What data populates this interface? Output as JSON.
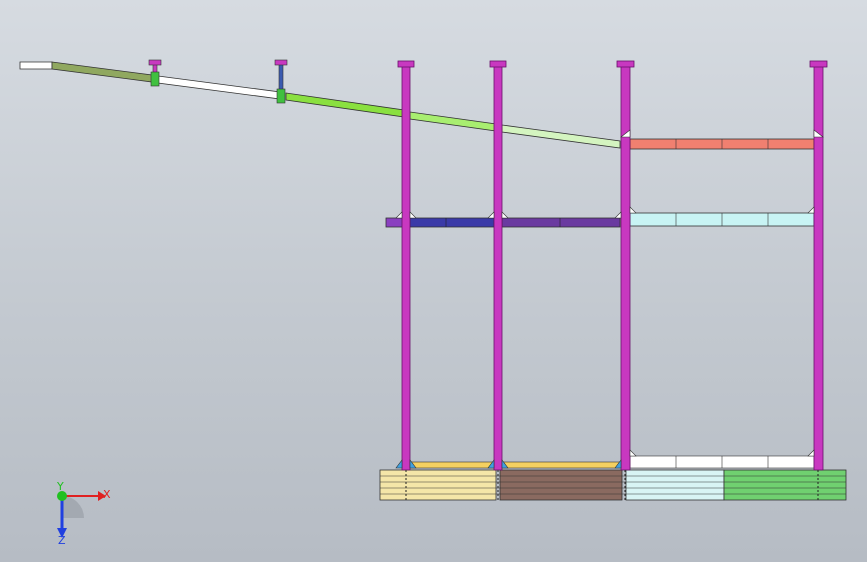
{
  "viewport": {
    "background_top": "#d6dbe1",
    "background_bottom": "#b6bcc4"
  },
  "triad": {
    "x_label": "X",
    "y_label": "Y",
    "z_label": "Z",
    "x_color": "#e02020",
    "y_color": "#20c020",
    "z_color": "#2040e0"
  },
  "colors": {
    "column": "#c838c0",
    "column_edge": "#6a106a",
    "beam_salmon": "#f08070",
    "beam_navy": "#3a3aa8",
    "beam_purple": "#6a3aa0",
    "beam_cyan": "#c8f4f4",
    "beam_green": "#8ae040",
    "beam_olive": "#90a860",
    "base_yellow": "#f4e6a8",
    "base_brown": "#8a6a60",
    "base_cyan": "#d8f4f4",
    "base_green": "#70d070"
  }
}
